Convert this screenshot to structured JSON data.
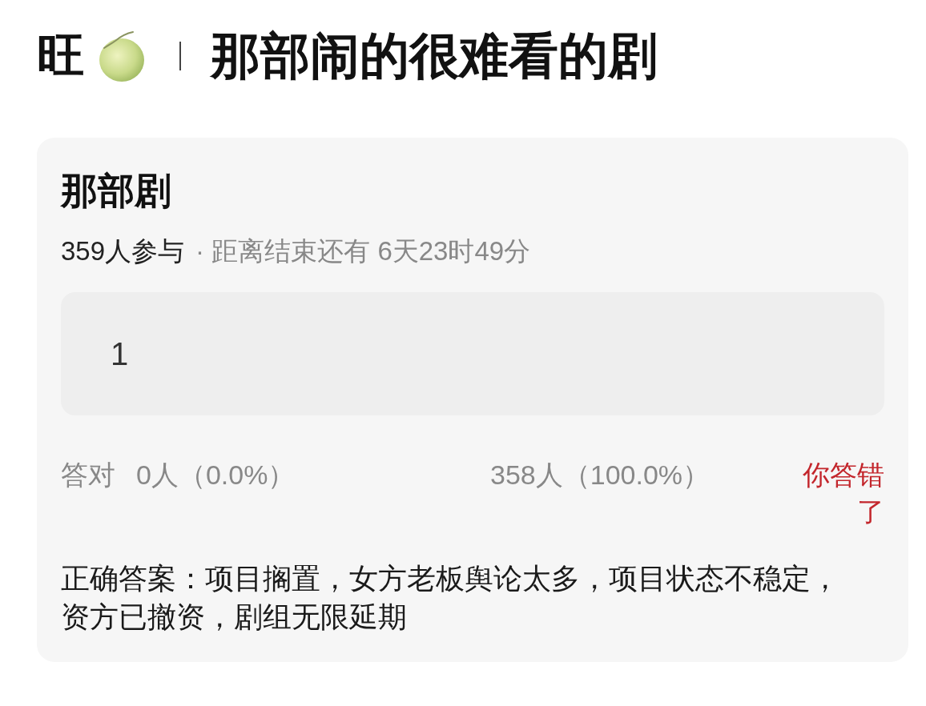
{
  "header": {
    "author": "旺",
    "title": "那部闹的很难看的剧"
  },
  "quiz": {
    "title": "那部剧",
    "participants": "359人参与",
    "deadline": "· 距离结束还有 6天23时49分",
    "answer": {
      "value": "1"
    },
    "result": {
      "label": "答对",
      "correct_count": "0人（0.0%）",
      "wrong_count": "358人（100.0%）",
      "verdict": {
        "text": "你答错了",
        "correct": false
      }
    },
    "correct_answer": "正确答案：项目搁置，女方老板舆论太多，项目状态不稳定，资方已撤资，剧组无限延期"
  }
}
